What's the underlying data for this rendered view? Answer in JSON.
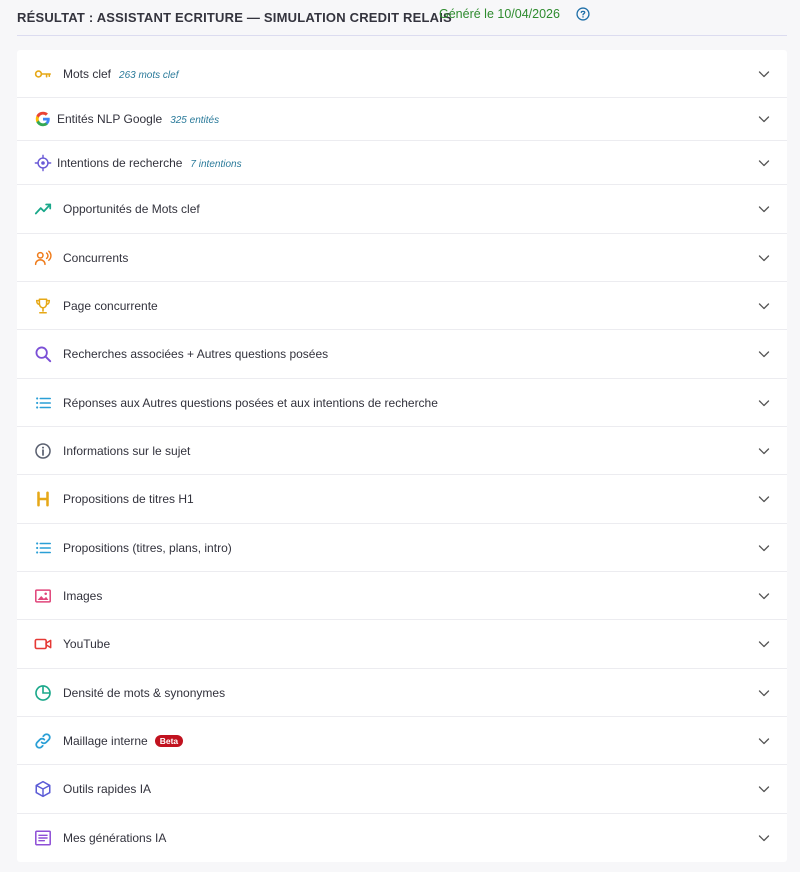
{
  "header": {
    "title": "RÉSULTAT : ASSISTANT ECRITURE — SIMULATION CREDIT RELAIS",
    "generated": "Généré le 10/04/2026",
    "help_icon": "help-circle-icon"
  },
  "rows": [
    {
      "label": "Mots clef",
      "count": "263 mots clef",
      "icon": "key-icon",
      "color": "#e6a817"
    },
    {
      "label": "Entités NLP Google",
      "count": "325 entités",
      "icon": "google-icon",
      "color": "#4285f4"
    },
    {
      "label": "Intentions de recherche",
      "count": "7 intentions",
      "icon": "target-icon",
      "color": "#6a5ad6"
    },
    {
      "label": "Opportunités de Mots clef",
      "icon": "trend-up-icon",
      "color": "#1aa88a"
    },
    {
      "label": "Concurrents",
      "icon": "users-signal-icon",
      "color": "#ef7b1a"
    },
    {
      "label": "Page concurrente",
      "icon": "trophy-icon",
      "color": "#e6a817"
    },
    {
      "label": "Recherches associées + Autres questions posées",
      "icon": "search-icon",
      "color": "#7b4fd6"
    },
    {
      "label": "Réponses aux Autres questions posées et aux intentions de recherche",
      "icon": "list-icon",
      "color": "#2a9fd6"
    },
    {
      "label": "Informations sur le sujet",
      "icon": "info-icon",
      "color": "#5a6070"
    },
    {
      "label": "Propositions de titres H1",
      "icon": "heading-icon",
      "color": "#e6a817"
    },
    {
      "label": "Propositions (titres, plans, intro)",
      "icon": "list-icon",
      "color": "#2a9fd6"
    },
    {
      "label": "Images",
      "icon": "image-icon",
      "color": "#e0457a"
    },
    {
      "label": "YouTube",
      "icon": "video-icon",
      "color": "#e53935"
    },
    {
      "label": "Densité de mots & synonymes",
      "icon": "pie-chart-icon",
      "color": "#1aa88a"
    },
    {
      "label": "Maillage interne",
      "badge": "Beta",
      "icon": "link-icon",
      "color": "#2a9fd6"
    },
    {
      "label": "Outils rapides IA",
      "icon": "cube-icon",
      "color": "#5b5bd6"
    },
    {
      "label": "Mes générations IA",
      "icon": "document-icon",
      "color": "#8e4fd6"
    }
  ],
  "chevron_icon": "chevron-down-icon"
}
